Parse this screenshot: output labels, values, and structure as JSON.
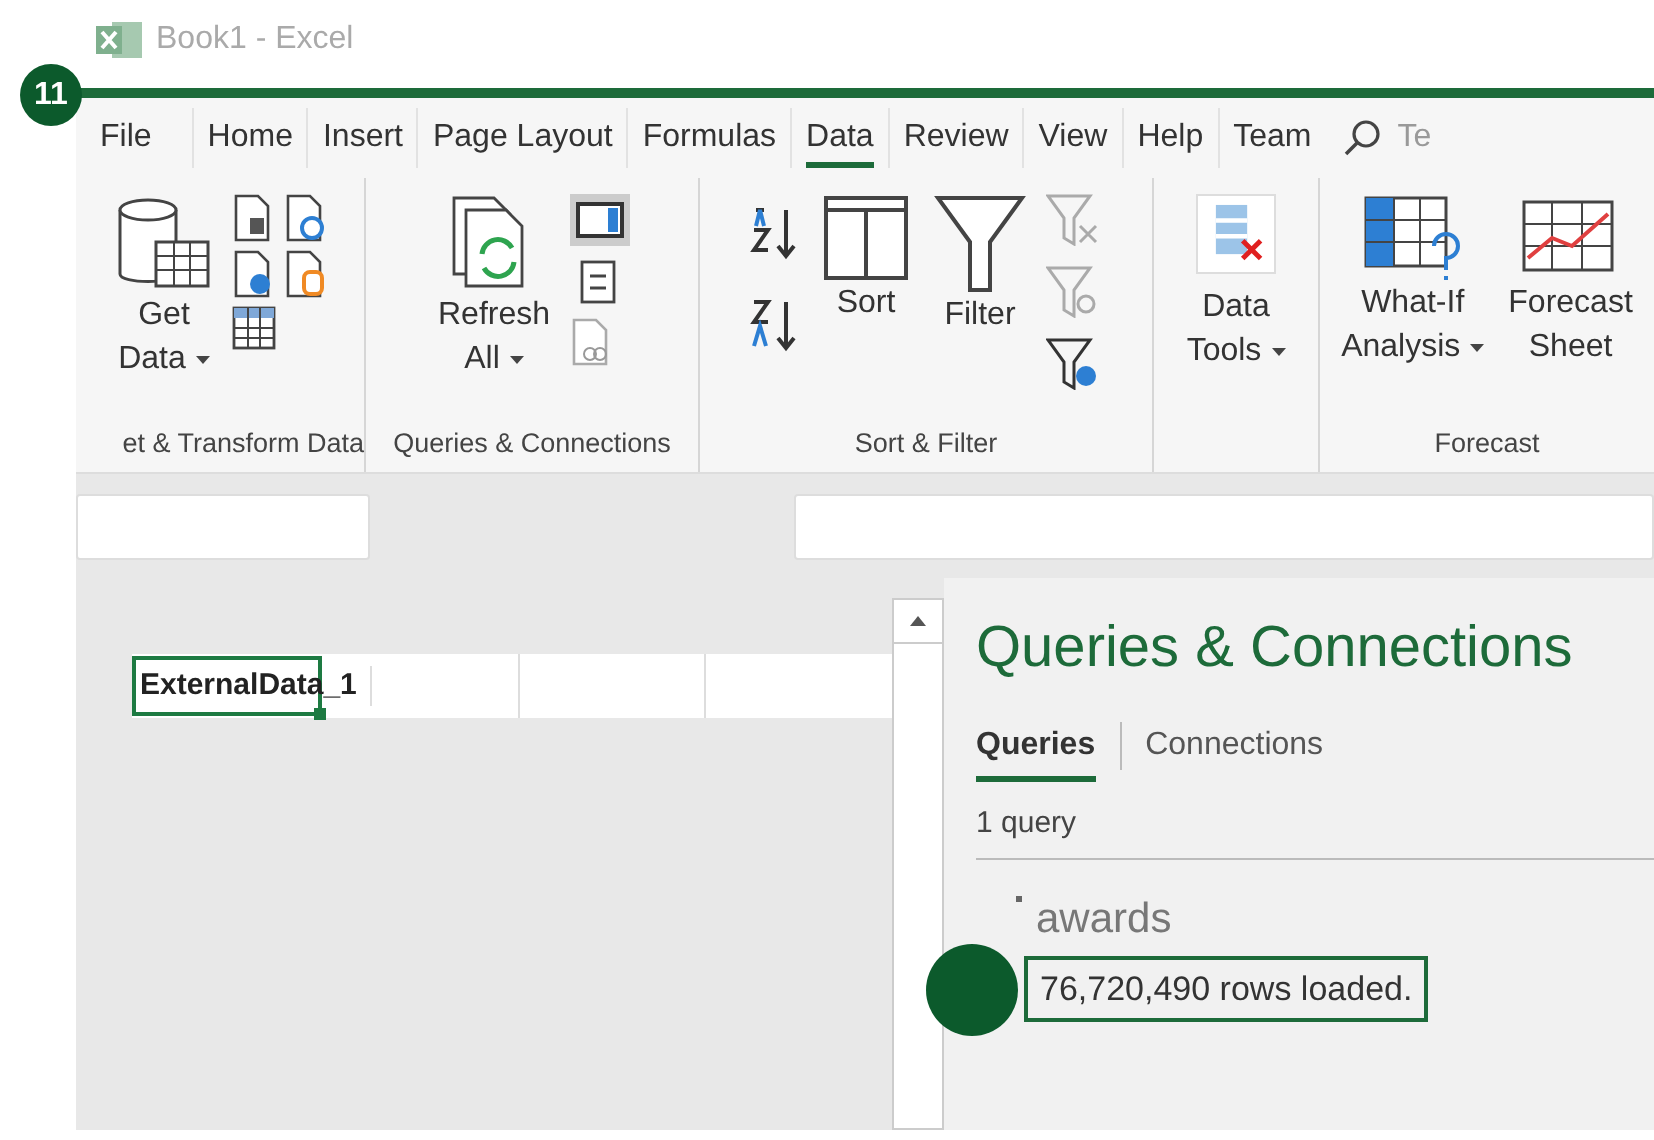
{
  "window": {
    "title": "Book1 - Excel"
  },
  "step_badge": "11",
  "ribbon_tabs": [
    {
      "label": "File",
      "selected": false
    },
    {
      "label": "Home",
      "selected": false
    },
    {
      "label": "Insert",
      "selected": false
    },
    {
      "label": "Page Layout",
      "selected": false
    },
    {
      "label": "Formulas",
      "selected": false
    },
    {
      "label": "Data",
      "selected": true
    },
    {
      "label": "Review",
      "selected": false
    },
    {
      "label": "View",
      "selected": false
    },
    {
      "label": "Help",
      "selected": false
    },
    {
      "label": "Team",
      "selected": false
    }
  ],
  "search": {
    "text": "Te"
  },
  "ribbon_groups": [
    {
      "label": "et & Transform Data",
      "commands": [
        {
          "lines": [
            "Get",
            "Data"
          ],
          "dropdown": true
        }
      ]
    },
    {
      "label": "Queries & Connections",
      "commands": [
        {
          "lines": [
            "Refresh",
            "All"
          ],
          "dropdown": true
        }
      ]
    },
    {
      "label": "Sort & Filter",
      "commands": [
        {
          "lines": [
            "Sort"
          ],
          "dropdown": false
        },
        {
          "lines": [
            "Filter"
          ],
          "dropdown": false
        }
      ]
    },
    {
      "commands": [
        {
          "lines": [
            "Data",
            "Tools"
          ],
          "dropdown": true
        }
      ]
    },
    {
      "label": "Forecast",
      "commands": [
        {
          "lines": [
            "What-If",
            "Analysis"
          ],
          "dropdown": true
        },
        {
          "lines": [
            "Forecast",
            "Sheet"
          ],
          "dropdown": false
        }
      ]
    }
  ],
  "sheet": {
    "cell": "ExternalData_1"
  },
  "pane": {
    "title": "Queries & Connections",
    "tabs": [
      {
        "label": "Queries",
        "selected": true
      },
      {
        "label": "Connections",
        "selected": false
      }
    ],
    "count": "1 query",
    "queries": [
      {
        "name": "awards",
        "status": "76,720,490 rows loaded.",
        "highlighted": true
      }
    ]
  }
}
